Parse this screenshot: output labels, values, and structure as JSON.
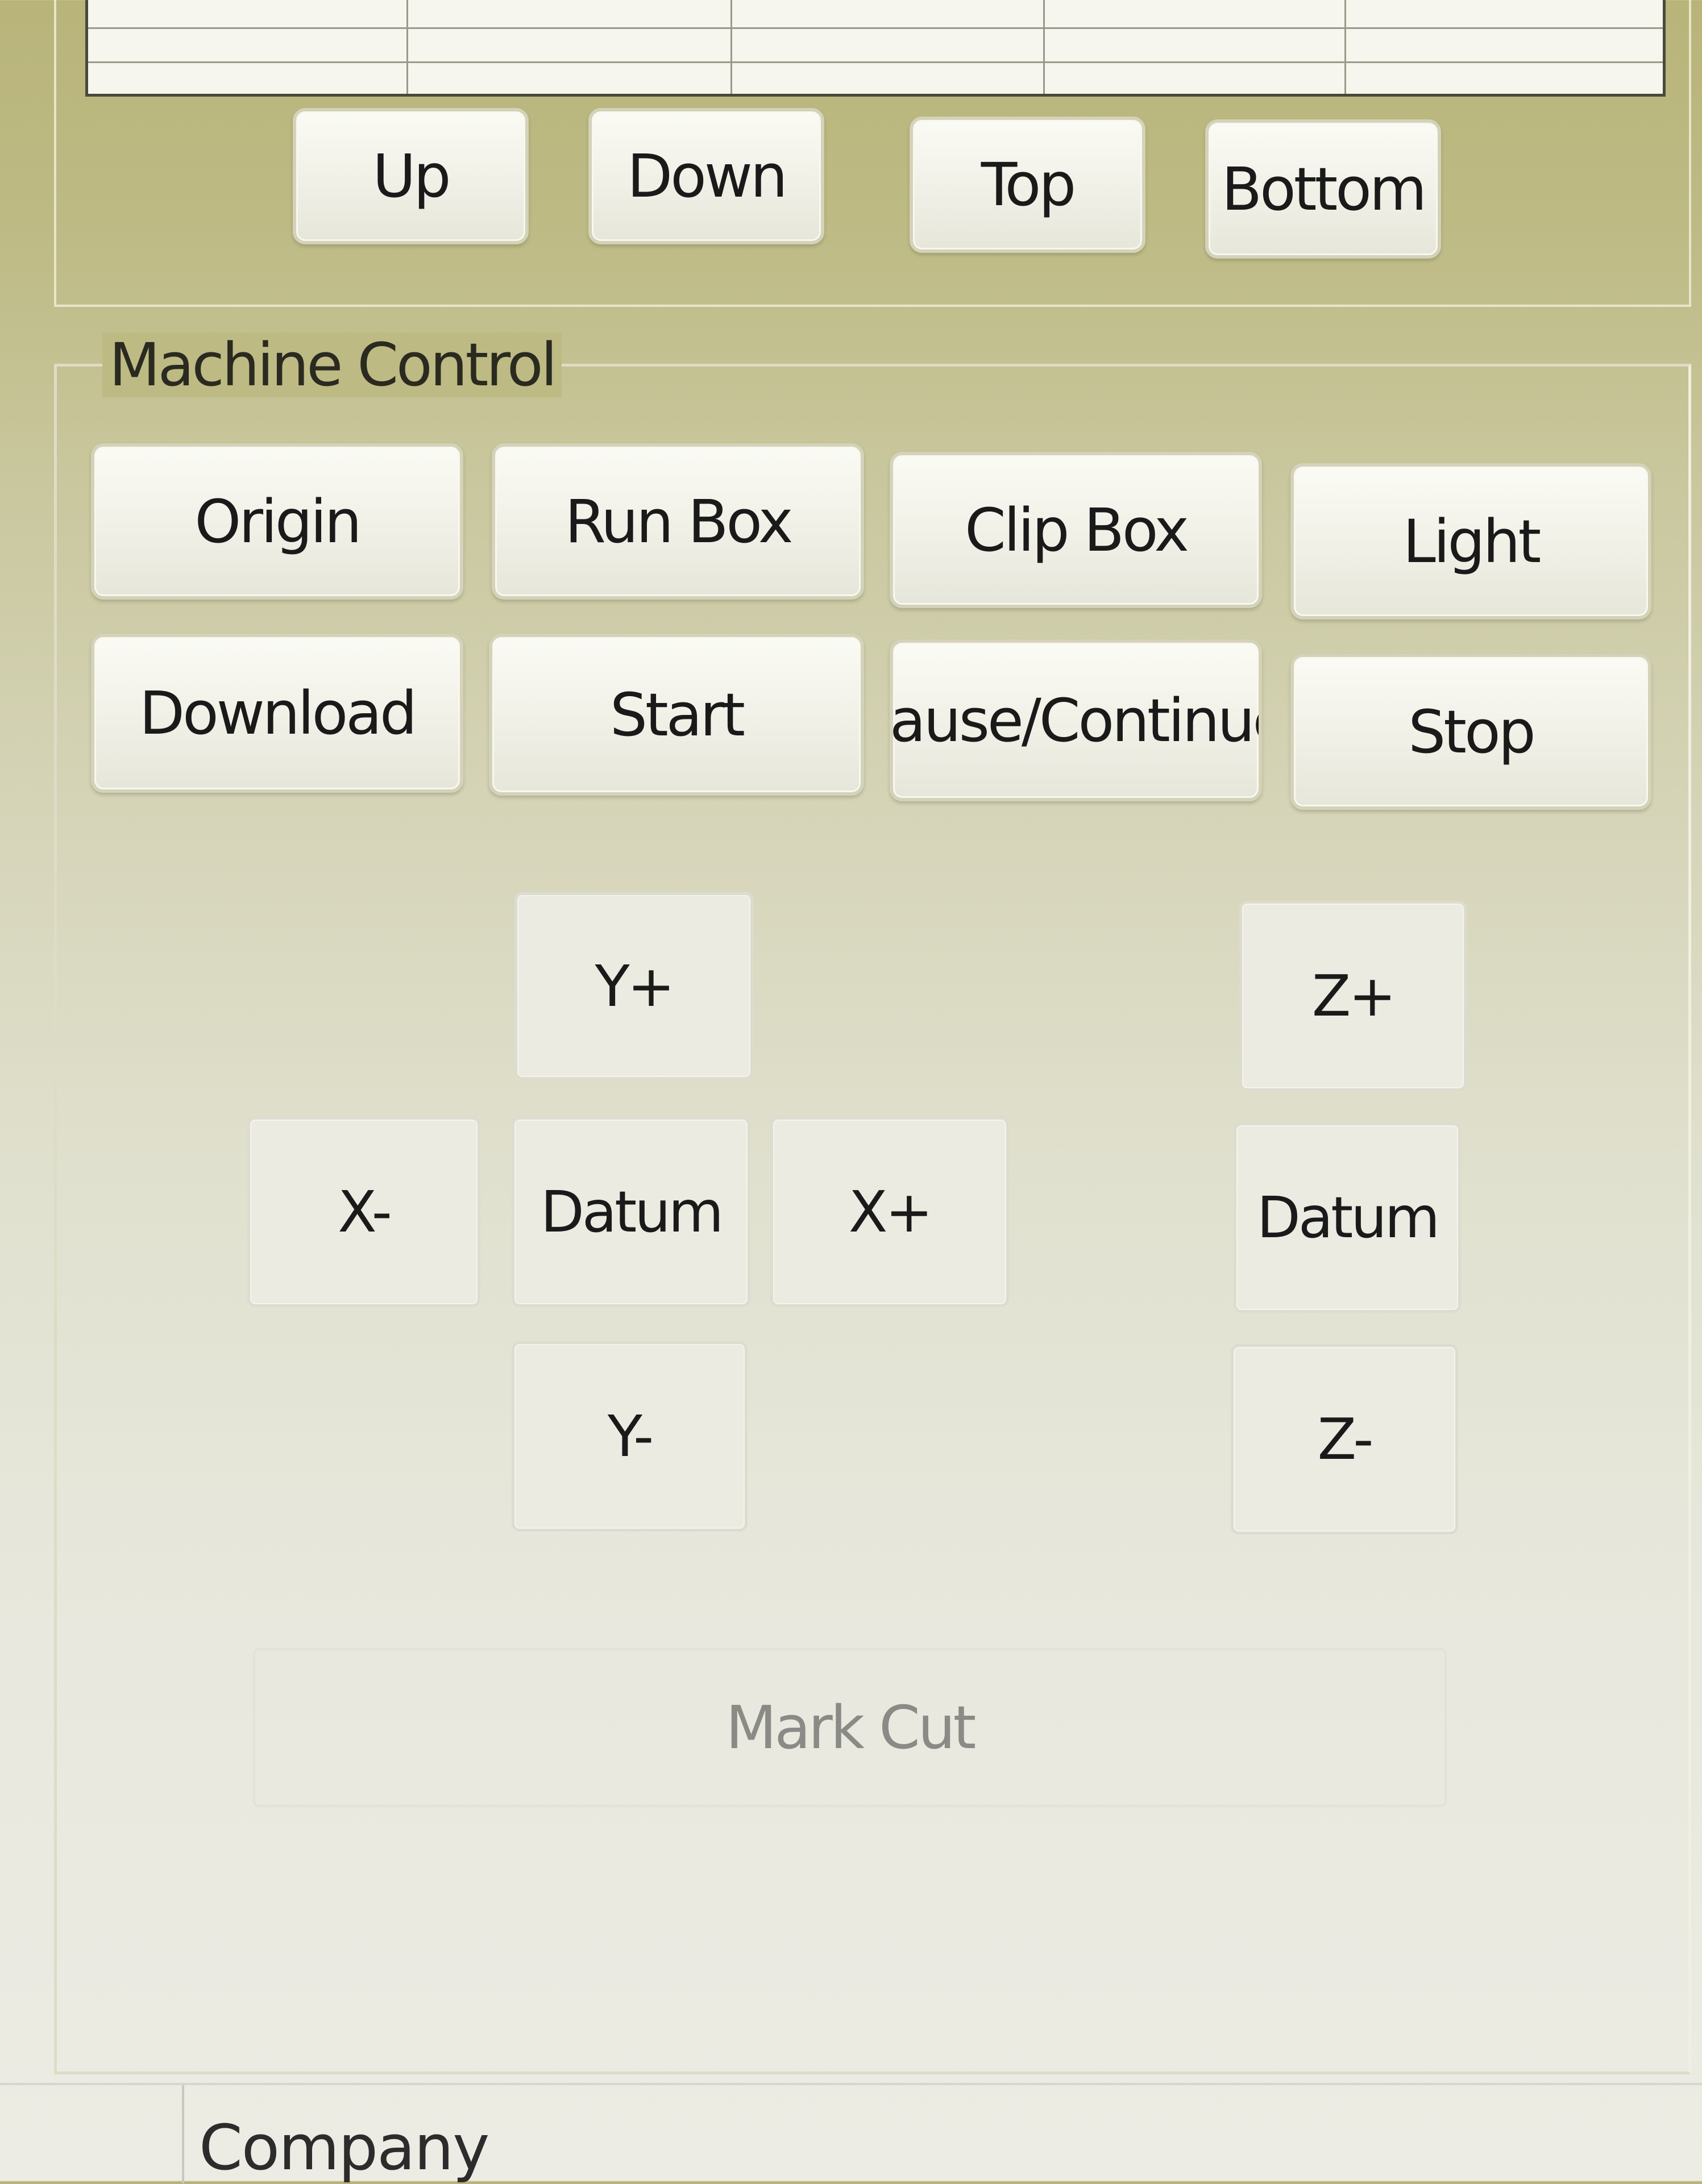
{
  "order_buttons": {
    "up": "Up",
    "down": "Down",
    "top": "Top",
    "bottom": "Bottom"
  },
  "machine_control": {
    "title": "Machine Control",
    "row1": [
      "Origin",
      "Run Box",
      "Clip Box",
      "Light"
    ],
    "row2": [
      "Download",
      "Start",
      "Pause/Continue",
      "Stop"
    ]
  },
  "jog": {
    "y_plus": "Y+",
    "y_minus": "Y-",
    "x_minus": "X-",
    "x_plus": "X+",
    "xy_datum": "Datum",
    "z_plus": "Z+",
    "z_minus": "Z-",
    "z_datum": "Datum"
  },
  "mark_cut": "Mark Cut",
  "status_bar": {
    "text": "Company"
  }
}
